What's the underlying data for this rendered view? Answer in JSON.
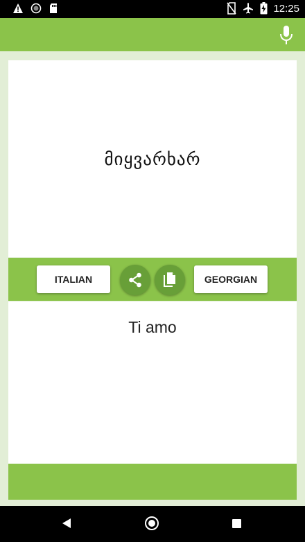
{
  "status_bar": {
    "time": "12:25",
    "icons_left": [
      "warning-icon",
      "circle-icon",
      "sd-card-icon"
    ],
    "icons_right": [
      "no-sim-icon",
      "airplane-icon",
      "battery-charging-icon"
    ]
  },
  "app_bar": {
    "mic_icon": "microphone-icon"
  },
  "translation": {
    "source_text": "მიყვარხარ",
    "target_text": "Ti amo"
  },
  "language_bar": {
    "left_language": "ITALIAN",
    "right_language": "GEORGIAN",
    "share_icon": "share-icon",
    "copy_icon": "copy-icon"
  },
  "nav_bar": {
    "back_icon": "back-icon",
    "home_icon": "home-icon",
    "recents_icon": "recents-icon"
  },
  "colors": {
    "primary": "#8bc34a",
    "primary_dark": "#689f38",
    "background": "#e2eed6"
  }
}
